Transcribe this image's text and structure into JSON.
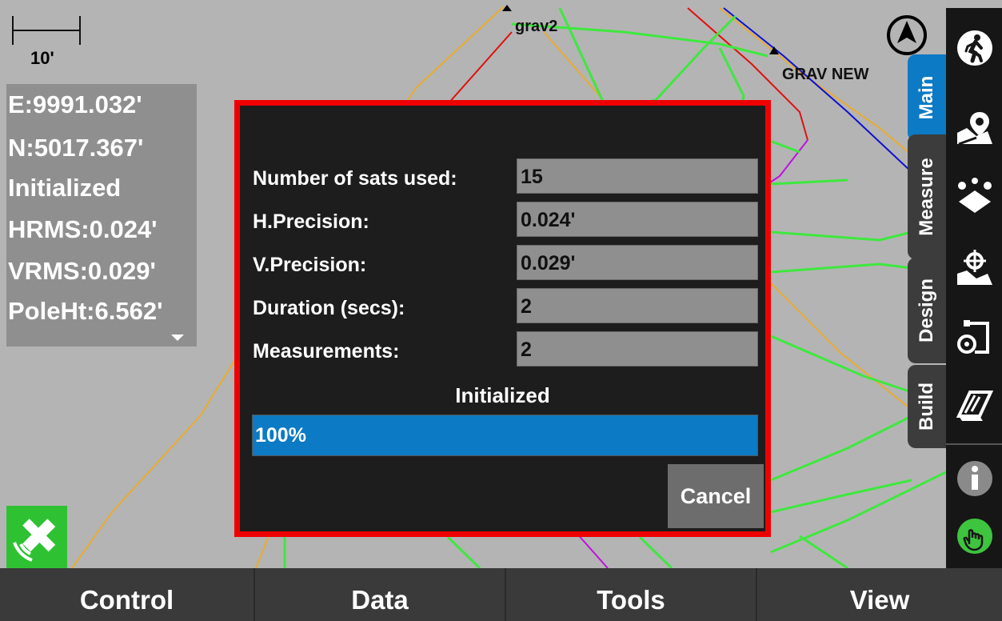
{
  "map": {
    "labels": {
      "grav2": "grav2",
      "grav_new": "GRAV NEW"
    },
    "scale_label": "10'"
  },
  "coords": {
    "lines": [
      "E:9991.032'",
      "N:5017.367'",
      "Initialized",
      "HRMS:0.024'",
      "VRMS:0.029'",
      "PoleHt:6.562'"
    ]
  },
  "dialog": {
    "rows": [
      {
        "label": "Number of sats used:",
        "value": "15"
      },
      {
        "label": "H.Precision:",
        "value": "0.024'"
      },
      {
        "label": "V.Precision:",
        "value": "0.029'"
      },
      {
        "label": "Duration (secs):",
        "value": "2"
      },
      {
        "label": "Measurements:",
        "value": "2"
      }
    ],
    "status": "Initialized",
    "progress_percent": 100,
    "progress_text": "100%",
    "cancel_label": "Cancel"
  },
  "tabs": [
    {
      "label": "Main",
      "active": true
    },
    {
      "label": "Measure",
      "active": false
    },
    {
      "label": "Design",
      "active": false
    },
    {
      "label": "Build",
      "active": false
    }
  ],
  "right_icons": [
    "walking-person-icon",
    "map-pin-icon",
    "points-icon",
    "crosshair-map-icon",
    "measure-tape-icon",
    "road-icon",
    "info-icon",
    "hand-icon"
  ],
  "bottom_nav": [
    "Control",
    "Data",
    "Tools",
    "View"
  ],
  "colors": {
    "dialog_border": "#ef0000",
    "progress_fill": "#0c7ac4",
    "active_tab": "#0c7ac4",
    "inactive_tab": "#3c3c3c",
    "gps_badge": "#2ec233",
    "line_green": "#3ee83e",
    "line_orange": "#e8ac30",
    "line_red": "#e01010",
    "line_blue": "#1010d0",
    "line_magenta": "#c010e0"
  }
}
